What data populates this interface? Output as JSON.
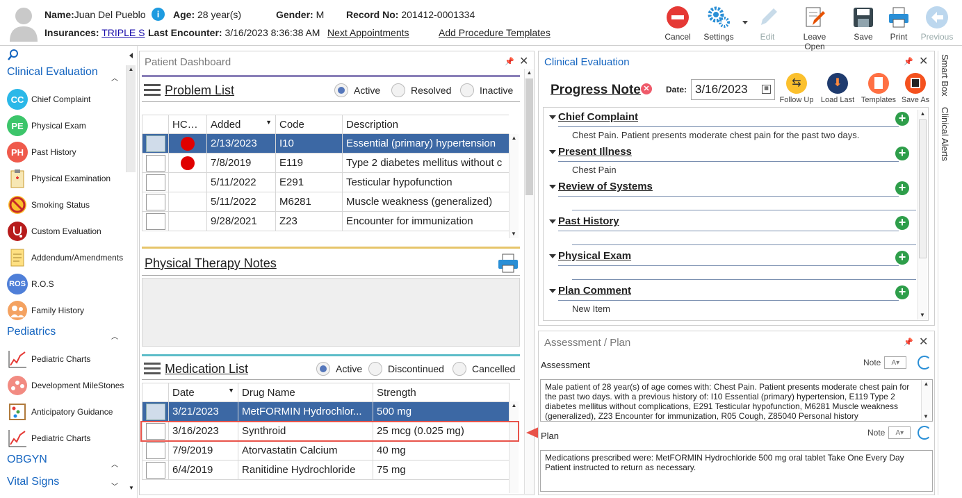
{
  "header": {
    "name_label": "Name:",
    "name_value": "Juan Del Pueblo",
    "age_label": "Age:",
    "age_value": "28 year(s)",
    "gender_label": "Gender:",
    "gender_value": "M",
    "record_label": "Record No:",
    "record_value": "201412-0001334",
    "insurance_label": "Insurances:",
    "insurance_value": "TRIPLE S",
    "last_encounter_label": "Last Encounter:",
    "last_encounter_value": "3/16/2023 8:36:38 AM",
    "next_appointments": "Next Appointments",
    "add_procedure_templates": "Add Procedure Templates"
  },
  "toolbar": {
    "cancel": "Cancel",
    "settings": "Settings",
    "edit": "Edit",
    "leave_open": "Leave Open",
    "save": "Save",
    "print": "Print",
    "previous": "Previous"
  },
  "sidebar": {
    "sections": {
      "clinical": "Clinical Evaluation",
      "pediatrics": "Pediatrics",
      "obgyn": "OBGYN",
      "vital": "Vital Signs"
    },
    "items": [
      {
        "label": "Chief Complaint",
        "badge": "CC"
      },
      {
        "label": "Physical Exam",
        "badge": "PE"
      },
      {
        "label": "Past History",
        "badge": "PH"
      },
      {
        "label": "Physical Examination"
      },
      {
        "label": "Smoking Status"
      },
      {
        "label": "Custom Evaluation"
      },
      {
        "label": "Addendum/Amendments"
      },
      {
        "label": "R.O.S",
        "badge": "ROS"
      },
      {
        "label": "Family History"
      },
      {
        "label": "Pediatric Charts"
      },
      {
        "label": "Development MileStones"
      },
      {
        "label": "Anticipatory Guidance"
      },
      {
        "label": "Pediatric Charts"
      }
    ]
  },
  "dashboard": {
    "title": "Patient Dashboard",
    "problem_list": {
      "title": "Problem List",
      "filters": [
        "Active",
        "Resolved",
        "Inactive"
      ],
      "columns": [
        "HCC",
        "Added",
        "Code",
        "Description"
      ],
      "rows": [
        {
          "hcc": true,
          "added": "2/13/2023",
          "code": "I10",
          "desc": "Essential (primary) hypertension"
        },
        {
          "hcc": true,
          "added": "7/8/2019",
          "code": "E119",
          "desc": "Type 2 diabetes mellitus without c"
        },
        {
          "hcc": false,
          "added": "5/11/2022",
          "code": "E291",
          "desc": "Testicular hypofunction"
        },
        {
          "hcc": false,
          "added": "5/11/2022",
          "code": "M6281",
          "desc": "Muscle weakness (generalized)"
        },
        {
          "hcc": false,
          "added": "9/28/2021",
          "code": "Z23",
          "desc": "Encounter for immunization"
        }
      ]
    },
    "pt_notes": {
      "title": "Physical Therapy Notes"
    },
    "medication_list": {
      "title": "Medication List",
      "filters": [
        "Active",
        "Discontinued",
        "Cancelled"
      ],
      "columns": [
        "Date",
        "Drug Name",
        "Strength"
      ],
      "rows": [
        {
          "date": "3/21/2023",
          "drug": "MetFORMIN Hydrochlor...",
          "strength": "500 mg"
        },
        {
          "date": "3/16/2023",
          "drug": "Synthroid",
          "strength": "25 mcg (0.025 mg)"
        },
        {
          "date": "7/9/2019",
          "drug": "Atorvastatin Calcium",
          "strength": "40 mg"
        },
        {
          "date": "6/4/2019",
          "drug": "Ranitidine Hydrochloride",
          "strength": "75 mg"
        }
      ]
    }
  },
  "clinical_eval": {
    "title": "Clinical Evaluation",
    "progress_note": "Progress Note",
    "date_label": "Date:",
    "date_value": "3/16/2023",
    "actions": [
      "Follow Up",
      "Load Last",
      "Templates",
      "Save As"
    ],
    "sections": [
      {
        "title": "Chief Complaint",
        "text": "Chest Pain. Patient presents moderate chest pain for the past two days."
      },
      {
        "title": "Present Illness",
        "text": "Chest Pain"
      },
      {
        "title": "Review of Systems",
        "text": ""
      },
      {
        "title": "Past History",
        "text": ""
      },
      {
        "title": "Physical Exam",
        "text": ""
      },
      {
        "title": "Plan Comment",
        "text": "New Item"
      }
    ]
  },
  "assessment_plan": {
    "title": "Assessment / Plan",
    "assessment_label": "Assessment",
    "note_label": "Note",
    "assessment_text": "Male patient of 28 year(s) of age comes with:  Chest Pain. Patient presents moderate chest pain for the past two days.   with a previous history of: I10 Essential (primary) hypertension, E119 Type 2 diabetes mellitus without complications, E291 Testicular hypofunction, M6281 Muscle weakness (generalized), Z23 Encounter for immunization, R05 Cough, Z85040 Personal history",
    "plan_label": "Plan",
    "plan_text": "Medications prescribed were: MetFORMIN Hydrochloride 500 mg oral tablet Take One Every Day      Patient instructed to return as necessary."
  },
  "right_rail": {
    "smart_box": "Smart Box",
    "clinical_alerts": "Clinical Alerts"
  },
  "colors": {
    "accent": "#1565c0",
    "selected_row": "#3c68a4",
    "highlight": "#e8534a",
    "add_green": "#2e9e4a"
  }
}
